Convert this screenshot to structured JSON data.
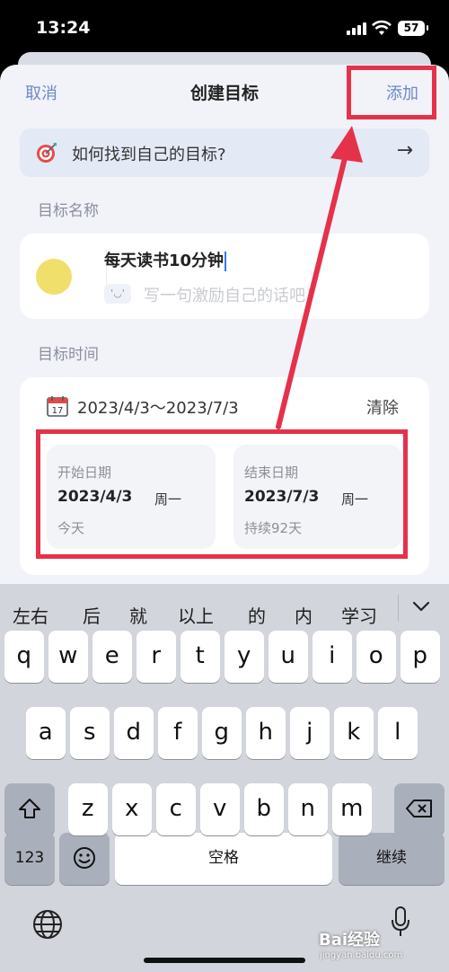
{
  "status_bar": {
    "time": "13:24",
    "battery": "57"
  },
  "nav": {
    "cancel": "取消",
    "title": "创建目标",
    "add": "添加"
  },
  "tip": {
    "text": "如何找到自己的目标?",
    "arrow": "→"
  },
  "name_section": {
    "label": "目标名称",
    "value": "每天读书10分钟",
    "motto_placeholder": "写一句激励自己的话吧！",
    "smiley": "'◡'"
  },
  "time_section": {
    "label": "目标时间",
    "range": "2023/4/3～2023/7/3",
    "clear": "清除",
    "calendar_day": "17",
    "start": {
      "label": "开始日期",
      "date": "2023/4/3",
      "weekday": "周一",
      "sub": "今天"
    },
    "end": {
      "label": "结束日期",
      "date": "2023/7/3",
      "weekday": "周一",
      "sub": "持续92天"
    }
  },
  "keyboard": {
    "candidates": [
      "左右",
      "后",
      "就",
      "以上",
      "的",
      "内",
      "学习"
    ],
    "row1": [
      "q",
      "w",
      "e",
      "r",
      "t",
      "y",
      "u",
      "i",
      "o",
      "p"
    ],
    "row2": [
      "a",
      "s",
      "d",
      "f",
      "g",
      "h",
      "j",
      "k",
      "l"
    ],
    "row3": [
      "z",
      "x",
      "c",
      "v",
      "b",
      "n",
      "m"
    ],
    "numbers_key": "123",
    "space_key": "空格",
    "continue_key": "继续"
  },
  "watermark": {
    "brand": "Bai经验",
    "url": "jingyan.baidu.com"
  },
  "colors": {
    "accent": "#6f88c6",
    "annotation": "#e5324b",
    "sheet_bg": "#f1f3f9",
    "keyboard_bg": "#d2d5db"
  }
}
